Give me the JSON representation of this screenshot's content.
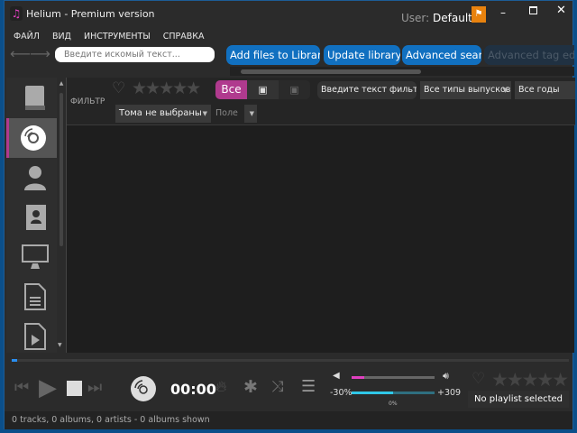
{
  "window": {
    "title": "Helium - Premium version",
    "user_label": "User:",
    "user_name": "Default"
  },
  "menu": [
    "ФАЙЛ",
    "ВИД",
    "ИНСТРУМЕНТЫ",
    "СПРАВКА"
  ],
  "toolbar": {
    "search_placeholder": "Введите искомый текст...",
    "buttons": [
      "Add files to Library...",
      "Update library...",
      "Advanced search",
      "Advanced tag edito"
    ]
  },
  "sidebar": {
    "items": [
      "library-icon",
      "album-icon",
      "artist-icon",
      "contacts-icon",
      "monitor-icon",
      "document-icon",
      "video-file-icon"
    ],
    "selected": 1
  },
  "filter": {
    "label": "ФИЛЬТР",
    "all_label": "Все",
    "text_placeholder": "Введите текст фильтра...",
    "release_types": "Все типы выпусков",
    "years": "Все годы",
    "volumes": "Тома не выбраны",
    "field_label": "Поле",
    "rating": 0
  },
  "player": {
    "time": "00:00",
    "balance_left": "-30%",
    "balance_right": "+309",
    "balance_value": "0%",
    "volume": 0.15,
    "pitch": 0.5,
    "progress": 0.01,
    "playlist": "No playlist selected",
    "rating": 0
  },
  "status": "0 tracks, 0 albums, 0 artists - 0 albums shown",
  "colors": {
    "accent": "#b03a8e",
    "button": "#1170c0",
    "volume": "#e040c0",
    "pitch": "#30c8e8"
  }
}
